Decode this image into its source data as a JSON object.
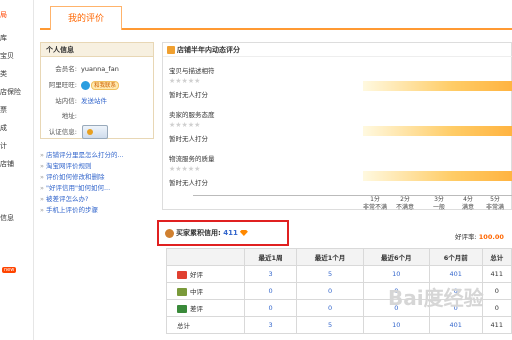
{
  "sidebar": {
    "items": [
      "局",
      "库",
      "宝贝",
      "类",
      "店保险",
      "票",
      "成",
      "计",
      "店铺",
      "",
      "",
      "信息",
      "",
      "",
      ""
    ],
    "new_badge": "new"
  },
  "tabs": {
    "active": "我的评价"
  },
  "personal_info": {
    "title": "个人信息",
    "member_label": "会员名:",
    "member_name": "yuanna_fan",
    "wangwang_label": "阿里旺旺:",
    "wangwang_status": "和我联系",
    "mailbox_label": "站内信:",
    "mailbox_link": "发送站件",
    "address_label": "地址:",
    "address_value": "",
    "cert_label": "认证信息:"
  },
  "help_links": [
    "店铺评分里是怎么打分的...",
    "淘宝网评价规则",
    "评价如何修改和删除",
    "\"好评信用\"如何如何...",
    "被差评怎么办?",
    "手机上评价的步骤"
  ],
  "dynamic_rating": {
    "title": "店铺半年内动态评分",
    "metrics": [
      {
        "name": "宝贝与描述相符",
        "stars": "★★★★★",
        "status": "暂时无人打分"
      },
      {
        "name": "卖家的服务态度",
        "stars": "★★★★★",
        "status": "暂时无人打分"
      },
      {
        "name": "物流服务的质量",
        "stars": "★★★★★",
        "status": "暂时无人打分"
      }
    ],
    "scale": [
      {
        "score": "1分",
        "label": "非常不满"
      },
      {
        "score": "2分",
        "label": "不满意"
      },
      {
        "score": "3分",
        "label": "一般"
      },
      {
        "score": "4分",
        "label": "满意"
      },
      {
        "score": "5分",
        "label": "非常满"
      }
    ]
  },
  "credit": {
    "label": "买家累积信用:",
    "value": "411",
    "score_label": "好评率:",
    "score_value": "100.00"
  },
  "stats_table": {
    "headers": [
      "",
      "最近1周",
      "最近1个月",
      "最近6个月",
      "6个月前",
      "总计"
    ],
    "rows": [
      {
        "label": "好评",
        "cells": [
          "3",
          "5",
          "10",
          "401",
          "411"
        ]
      },
      {
        "label": "中评",
        "cells": [
          "0",
          "0",
          "0",
          "0",
          "0"
        ]
      },
      {
        "label": "差评",
        "cells": [
          "0",
          "0",
          "0",
          "0",
          "0"
        ]
      },
      {
        "label": "总计",
        "cells": [
          "3",
          "5",
          "10",
          "401",
          "411"
        ]
      }
    ]
  },
  "watermark": "Bai度经验"
}
